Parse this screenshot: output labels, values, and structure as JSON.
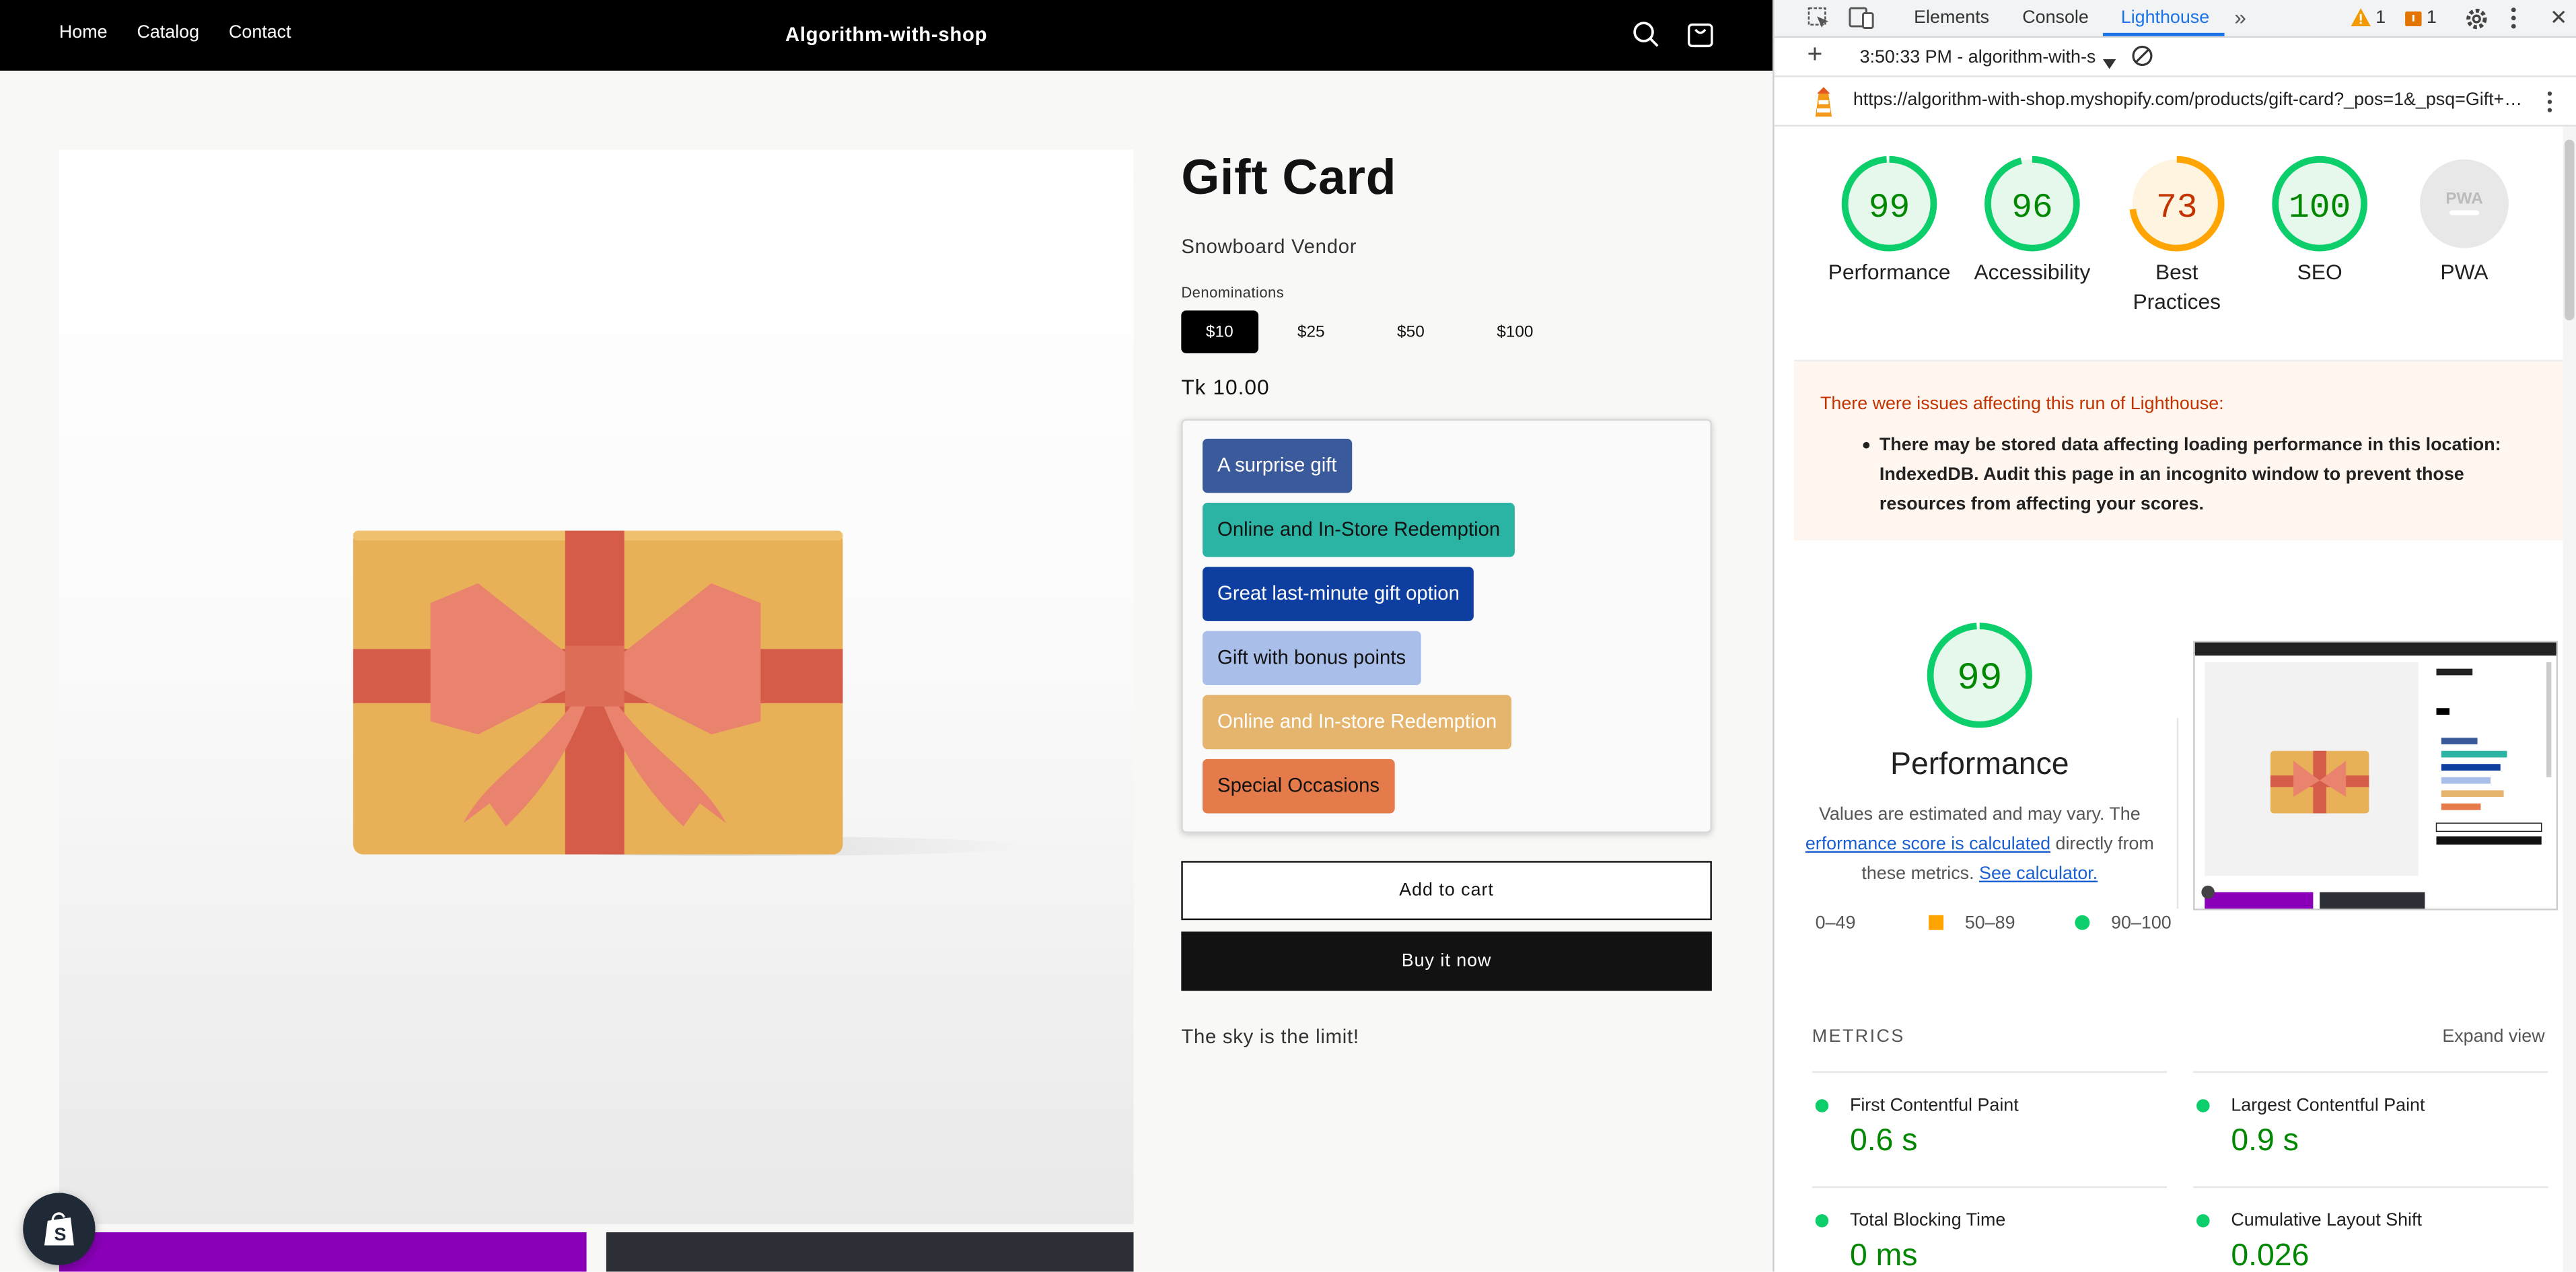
{
  "store": {
    "nav": [
      "Home",
      "Catalog",
      "Contact"
    ],
    "brand": "Algorithm-with-shop",
    "product": {
      "title": "Gift Card",
      "vendor": "Snowboard Vendor",
      "denom_label": "Denominations",
      "denominations": [
        "$10",
        "$25",
        "$50",
        "$100"
      ],
      "selected_denomination": "$10",
      "price": "Tk 10.00",
      "tags": [
        {
          "label": "A surprise gift",
          "bg": "#3a5a9b",
          "fg": "#ffffff"
        },
        {
          "label": "Online and In-Store Redemption",
          "bg": "#2bb3a3",
          "fg": "#121212"
        },
        {
          "label": "Great last-minute gift option",
          "bg": "#0e3fa0",
          "fg": "#ffffff"
        },
        {
          "label": "Gift with bonus points",
          "bg": "#a9bee8",
          "fg": "#121212"
        },
        {
          "label": "Online and In-store Redemption",
          "bg": "#e5b46d",
          "fg": "#ffffff"
        },
        {
          "label": "Special Occasions",
          "bg": "#e57a4a",
          "fg": "#121212"
        }
      ],
      "add_to_cart": "Add to cart",
      "buy_now": "Buy it now",
      "description": "The sky is the limit!"
    },
    "thumb_colors": [
      "#8a00b8",
      "#2c2f36"
    ]
  },
  "devtools": {
    "tabs": [
      "Elements",
      "Console",
      "Lighthouse"
    ],
    "active_tab": "Lighthouse",
    "warnings_count": "1",
    "issues_count": "1",
    "report_select": "3:50:33 PM - algorithm-with-s",
    "url": "https://algorithm-with-shop.myshopify.com/products/gift-card?_pos=1&_psq=Gift+C...",
    "gauges": [
      {
        "score": "99",
        "label": "Performance",
        "color": "#0cce6b",
        "text": "#008800",
        "bg": "#e6f7ec",
        "value": 0.99
      },
      {
        "score": "96",
        "label": "Accessibility",
        "color": "#0cce6b",
        "text": "#008800",
        "bg": "#e6f7ec",
        "value": 0.96
      },
      {
        "score": "73",
        "label": "Best Practices",
        "color": "#ffa400",
        "text": "#c33300",
        "bg": "#fff4e0",
        "value": 0.73
      },
      {
        "score": "100",
        "label": "SEO",
        "color": "#0cce6b",
        "text": "#008800",
        "bg": "#e6f7ec",
        "value": 1.0
      },
      {
        "score": "PWA",
        "label": "PWA",
        "color": "#dadada",
        "text": "#bbbbbb",
        "bg": "#e8e8e8",
        "value": 0
      }
    ],
    "warning": {
      "title": "There were issues affecting this run of Lighthouse:",
      "body": "There may be stored data affecting loading performance in this location: IndexedDB. Audit this page in an incognito window to prevent those resources from affecting your scores."
    },
    "perf": {
      "score": "99",
      "title": "Performance",
      "desc_pre": "Values are estimated and may vary. The",
      "desc_link": "erformance score is calculated",
      "desc_mid": "directly from these metrics.",
      "desc_link2": "See calculator."
    },
    "legend": [
      {
        "range": "0–49",
        "color": "#ff4e42"
      },
      {
        "range": "50–89",
        "color": "#ffa400"
      },
      {
        "range": "90–100",
        "color": "#0cce6b"
      }
    ],
    "metrics_head": "METRICS",
    "expand_view": "Expand view",
    "metrics": [
      {
        "name": "First Contentful Paint",
        "value": "0.6 s"
      },
      {
        "name": "Largest Contentful Paint",
        "value": "0.9 s"
      },
      {
        "name": "Total Blocking Time",
        "value": "0 ms"
      },
      {
        "name": "Cumulative Layout Shift",
        "value": "0.026"
      }
    ]
  }
}
